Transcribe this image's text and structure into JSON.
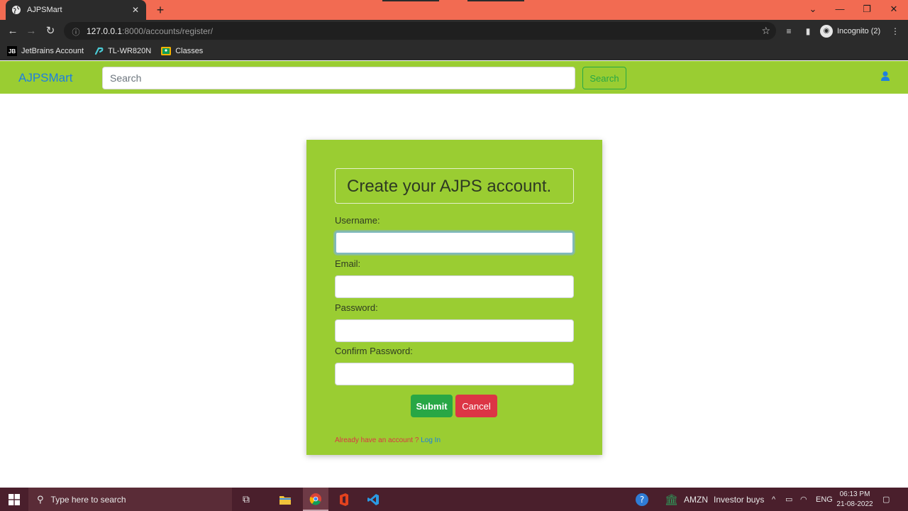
{
  "browser": {
    "tab_title": "AJPSMart",
    "tab_close": "✕",
    "new_tab": "+",
    "url_host": "127.0.0.1",
    "url_path": ":8000/accounts/register/",
    "incognito_label": "Incognito (2)",
    "bookmarks": [
      {
        "label": "JetBrains Account",
        "icon": "jetbrains-icon"
      },
      {
        "label": "TL-WR820N",
        "icon": "tplink-icon"
      },
      {
        "label": "Classes",
        "icon": "classroom-icon"
      }
    ]
  },
  "navbar": {
    "brand": "AJPSMart",
    "search_placeholder": "Search",
    "search_button": "Search",
    "brand_color": "#1d7fe0",
    "bar_color": "#9acd32"
  },
  "register": {
    "heading": "Create your AJPS account.",
    "fields": [
      {
        "label": "Username:",
        "value": ""
      },
      {
        "label": "Email:",
        "value": ""
      },
      {
        "label": "Password:",
        "value": ""
      },
      {
        "label": "Confirm Password:",
        "value": ""
      }
    ],
    "submit_label": "Submit",
    "cancel_label": "Cancel",
    "already_text": "Already have an account ?",
    "login_link": "Log In"
  },
  "taskbar": {
    "search_placeholder": "Type here to search",
    "stock_ticker": "AMZN",
    "stock_news": "Investor buys",
    "language": "ENG",
    "time": "06:13 PM",
    "date": "21-08-2022"
  }
}
